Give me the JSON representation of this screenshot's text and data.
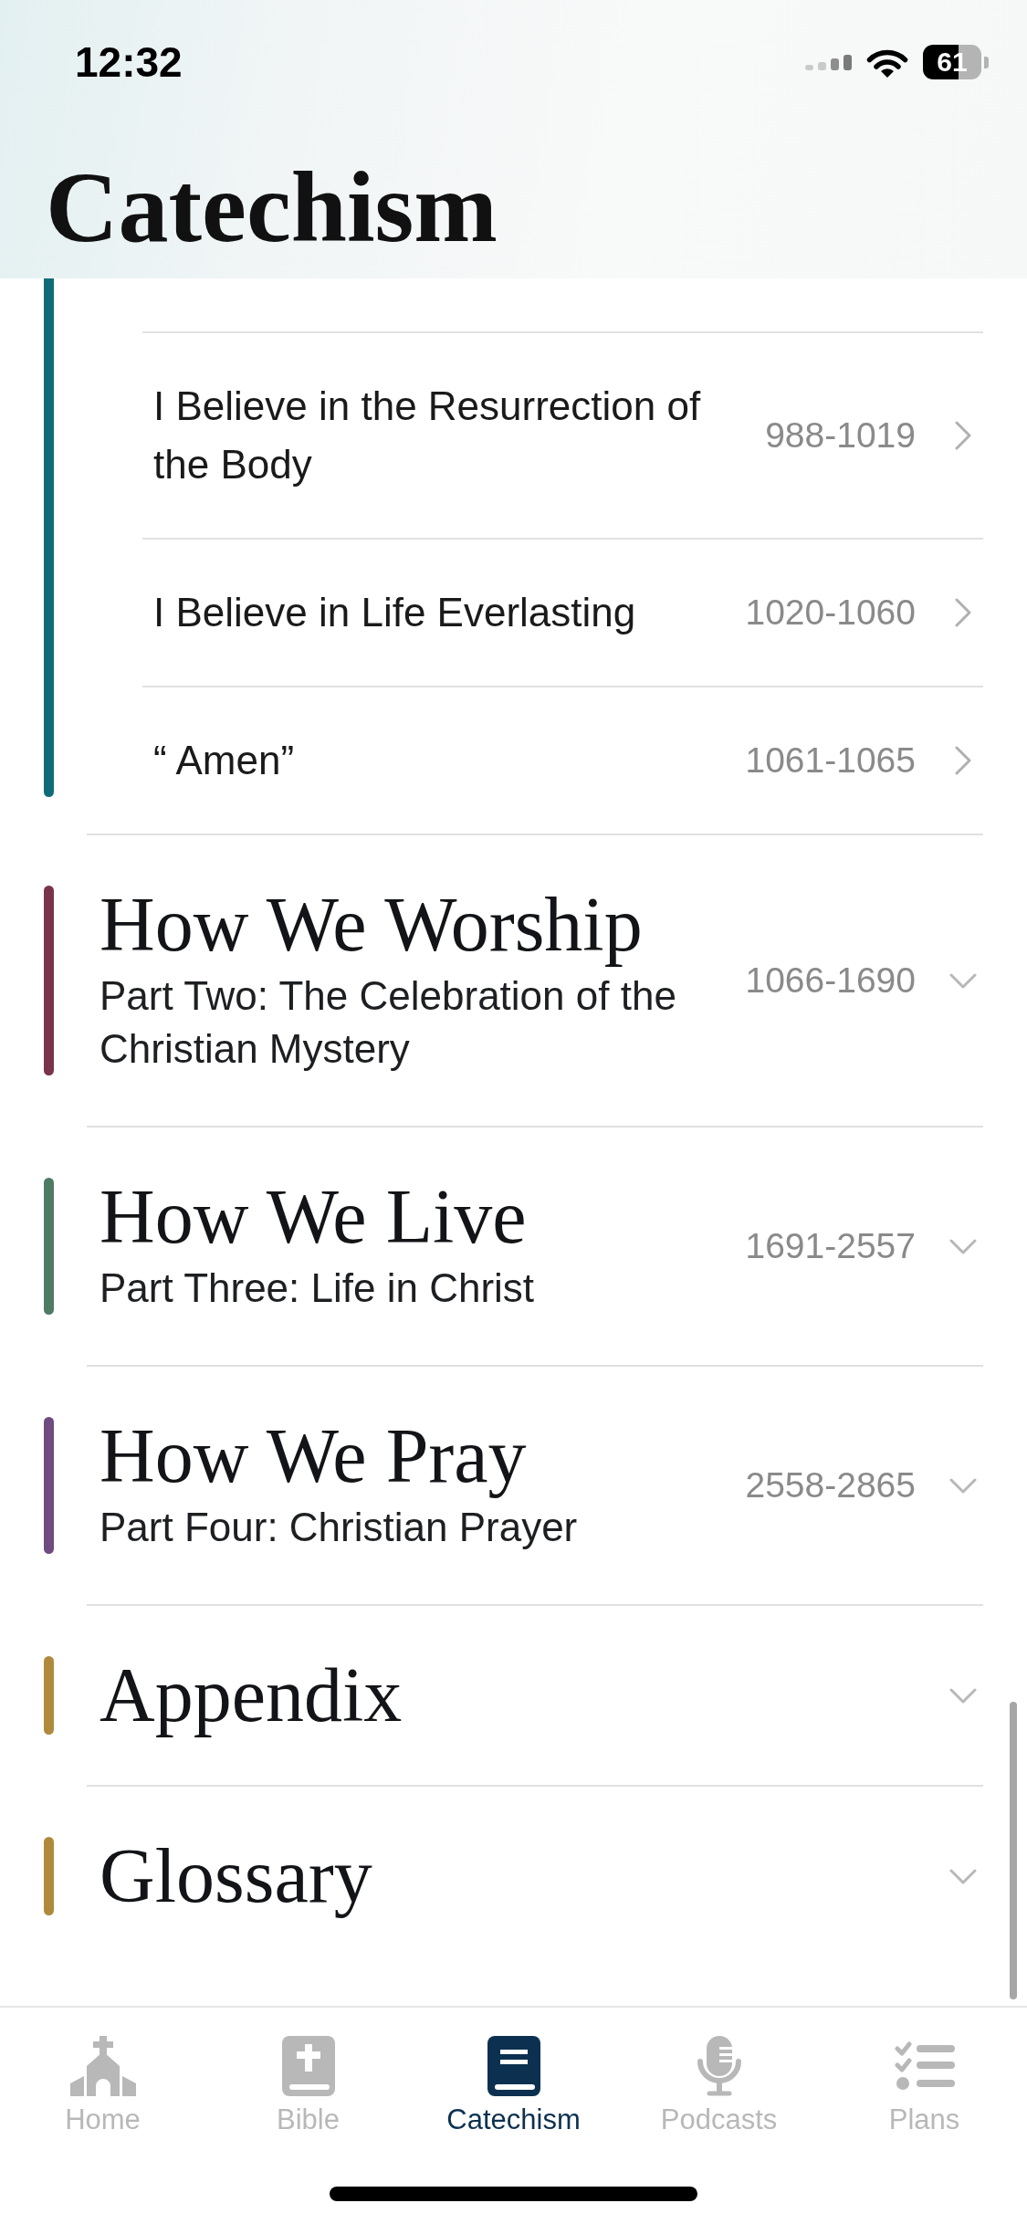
{
  "status_bar": {
    "time": "12:32",
    "battery": "61"
  },
  "header": {
    "title": "Catechism"
  },
  "sections": [
    {
      "color": "#0f6b78",
      "expanded": true,
      "chapters": [
        {
          "title": "I Believe in the Resurrection of the Body",
          "range": "988-1019"
        },
        {
          "title": "I Believe in Life Everlasting",
          "range": "1020-1060"
        },
        {
          "title": "“ Amen”",
          "range": "1061-1065"
        }
      ]
    },
    {
      "title": "How We Worship",
      "subtitle": "Part Two: The Celebration of the Christian Mystery",
      "range": "1066-1690",
      "color": "#7a3449",
      "expanded": false
    },
    {
      "title": "How We Live",
      "subtitle": "Part Three: Life in Christ",
      "range": "1691-2557",
      "color": "#4f7b65",
      "expanded": false
    },
    {
      "title": "How We Pray",
      "subtitle": "Part Four: Christian Prayer",
      "range": "2558-2865",
      "color": "#6f4b80",
      "expanded": false
    },
    {
      "title": "Appendix",
      "color": "#b08a3c",
      "expanded": false
    },
    {
      "title": "Glossary",
      "color": "#b08a3c",
      "expanded": false
    }
  ],
  "tab_bar": [
    {
      "label": "Home",
      "selected": false
    },
    {
      "label": "Bible",
      "selected": false
    },
    {
      "label": "Catechism",
      "selected": true
    },
    {
      "label": "Podcasts",
      "selected": false
    },
    {
      "label": "Plans",
      "selected": false
    }
  ]
}
